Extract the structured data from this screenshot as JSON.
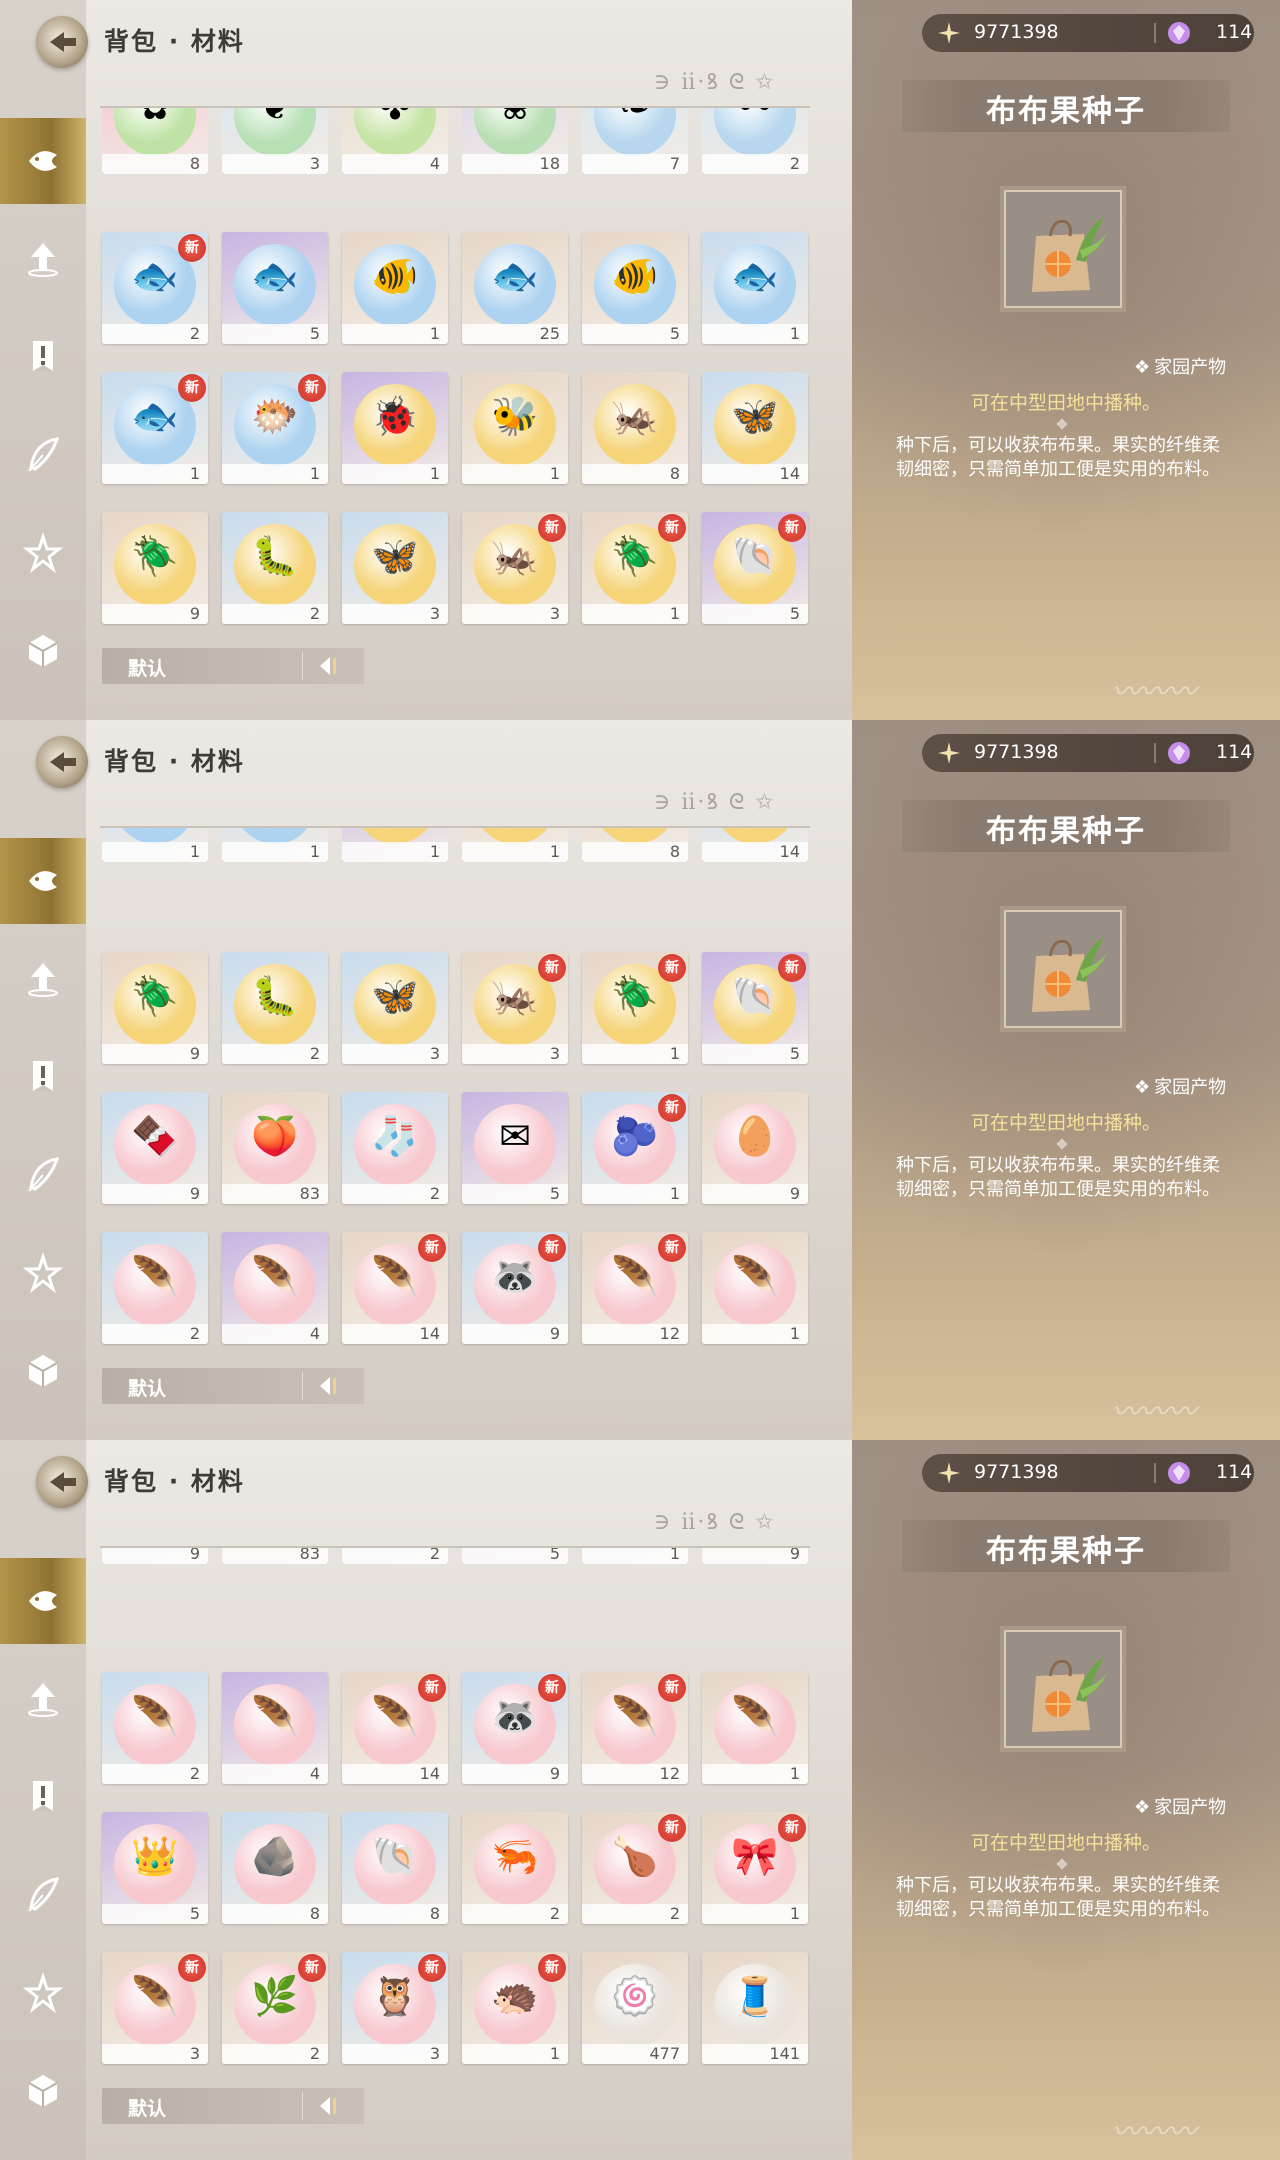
{
  "header": {
    "title": "背包 · 材料",
    "deco_text": "∋ ⅱ·ꝸ ᘓ ✩"
  },
  "sort": {
    "label": "默认"
  },
  "detail": {
    "gold": "9771398",
    "gems": "114",
    "name": "布布果种子",
    "category": "家园产物",
    "plant_hint": "可在中型田地中播种。",
    "description": "种下后，可以收获布布果。果实的纤维柔韧细密，只需简单加工便是实用的布料。"
  },
  "sidebar": [
    "fish-icon",
    "upgrade-icon",
    "quest-icon",
    "feather-icon",
    "star-icon",
    "box-icon"
  ],
  "panels": [
    {
      "rows": [
        {
          "partial": true,
          "cells": [
            {
              "qty": "8",
              "color": "#f4c6cf",
              "orb": "#bfe3a5",
              "glyph": "✿",
              "new": false
            },
            {
              "qty": "3",
              "color": "#d6e5ef",
              "orb": "#b8e0b5",
              "glyph": "❦",
              "new": false
            },
            {
              "qty": "4",
              "color": "#e9dfcf",
              "orb": "#c5e3a3",
              "glyph": "✤",
              "new": false
            },
            {
              "qty": "18",
              "color": "#dcd5ea",
              "orb": "#b9deb3",
              "glyph": "❀",
              "new": false
            },
            {
              "qty": "7",
              "color": "#d6e5ef",
              "orb": "#b6d7ee",
              "glyph": "❧",
              "new": false
            },
            {
              "qty": "2",
              "color": "#d6e5ef",
              "orb": "#b6d7ee",
              "glyph": "〰",
              "new": false
            }
          ]
        },
        {
          "partial": false,
          "cells": [
            {
              "qty": "2",
              "color": "#c9dcee",
              "orb": "#aed3f0",
              "glyph": "🐟",
              "new": true
            },
            {
              "qty": "5",
              "color": "#c7b5e2",
              "orb": "#aed3f0",
              "glyph": "🐟",
              "new": false
            },
            {
              "qty": "1",
              "color": "#e6d7c7",
              "orb": "#aed3f0",
              "glyph": "🐠",
              "new": false
            },
            {
              "qty": "25",
              "color": "#e6d7c7",
              "orb": "#aed3f0",
              "glyph": "🐟",
              "new": false
            },
            {
              "qty": "5",
              "color": "#e6d7c7",
              "orb": "#aed3f0",
              "glyph": "🐠",
              "new": false
            },
            {
              "qty": "1",
              "color": "#c9dcee",
              "orb": "#aed3f0",
              "glyph": "🐟",
              "new": false
            }
          ]
        },
        {
          "partial": false,
          "cells": [
            {
              "qty": "1",
              "color": "#c9dcee",
              "orb": "#aed3f0",
              "glyph": "🐟",
              "new": true
            },
            {
              "qty": "1",
              "color": "#c9dcee",
              "orb": "#aed3f0",
              "glyph": "🐡",
              "new": true
            },
            {
              "qty": "1",
              "color": "#c7b5e2",
              "orb": "#f5d47a",
              "glyph": "🐞",
              "new": false
            },
            {
              "qty": "1",
              "color": "#e6d7c7",
              "orb": "#f5d47a",
              "glyph": "🐝",
              "new": false
            },
            {
              "qty": "8",
              "color": "#e6d7c7",
              "orb": "#f5d47a",
              "glyph": "🦗",
              "new": false
            },
            {
              "qty": "14",
              "color": "#c9dcee",
              "orb": "#f5d47a",
              "glyph": "🦋",
              "new": false
            }
          ]
        },
        {
          "partial": false,
          "cells": [
            {
              "qty": "9",
              "color": "#e6d7c7",
              "orb": "#f5d47a",
              "glyph": "🪲",
              "new": false
            },
            {
              "qty": "2",
              "color": "#c9dcee",
              "orb": "#f5d47a",
              "glyph": "🐛",
              "new": false
            },
            {
              "qty": "3",
              "color": "#c9dcee",
              "orb": "#f5d47a",
              "glyph": "🦋",
              "new": false
            },
            {
              "qty": "3",
              "color": "#e6d7c7",
              "orb": "#f5d47a",
              "glyph": "🦗",
              "new": true
            },
            {
              "qty": "1",
              "color": "#e6d7c7",
              "orb": "#f5d47a",
              "glyph": "🪲",
              "new": true
            },
            {
              "qty": "5",
              "color": "#c7b5e2",
              "orb": "#f5d47a",
              "glyph": "🐚",
              "new": true
            }
          ]
        }
      ]
    },
    {
      "rows": [
        {
          "partial": true,
          "cells": [
            {
              "qty": "1",
              "color": "#c9dcee",
              "orb": "#aed3f0",
              "glyph": "🐟",
              "new": false
            },
            {
              "qty": "1",
              "color": "#c9dcee",
              "orb": "#aed3f0",
              "glyph": "🐡",
              "new": false
            },
            {
              "qty": "1",
              "color": "#c7b5e2",
              "orb": "#f5d47a",
              "glyph": "🐞",
              "new": false
            },
            {
              "qty": "1",
              "color": "#e6d7c7",
              "orb": "#f5d47a",
              "glyph": "🐝",
              "new": false
            },
            {
              "qty": "8",
              "color": "#e6d7c7",
              "orb": "#f5d47a",
              "glyph": "🦗",
              "new": false
            },
            {
              "qty": "14",
              "color": "#c9dcee",
              "orb": "#f5d47a",
              "glyph": "🦋",
              "new": false
            }
          ]
        },
        {
          "partial": false,
          "cells": [
            {
              "qty": "9",
              "color": "#e6d7c7",
              "orb": "#f5d47a",
              "glyph": "🪲",
              "new": false
            },
            {
              "qty": "2",
              "color": "#c9dcee",
              "orb": "#f5d47a",
              "glyph": "🐛",
              "new": false
            },
            {
              "qty": "3",
              "color": "#c9dcee",
              "orb": "#f5d47a",
              "glyph": "🦋",
              "new": false
            },
            {
              "qty": "3",
              "color": "#e6d7c7",
              "orb": "#f5d47a",
              "glyph": "🦗",
              "new": true
            },
            {
              "qty": "1",
              "color": "#e6d7c7",
              "orb": "#f5d47a",
              "glyph": "🪲",
              "new": true
            },
            {
              "qty": "5",
              "color": "#c7b5e2",
              "orb": "#f5d47a",
              "glyph": "🐚",
              "new": true
            }
          ]
        },
        {
          "partial": false,
          "cells": [
            {
              "qty": "9",
              "color": "#c9dcee",
              "orb": "#f7c9cf",
              "glyph": "🍫",
              "new": false
            },
            {
              "qty": "83",
              "color": "#e6d7c7",
              "orb": "#f7c9cf",
              "glyph": "🍑",
              "new": false
            },
            {
              "qty": "2",
              "color": "#c9dcee",
              "orb": "#f7c9cf",
              "glyph": "🧦",
              "new": false
            },
            {
              "qty": "5",
              "color": "#c7b5e2",
              "orb": "#f7c9cf",
              "glyph": "✉",
              "new": false
            },
            {
              "qty": "1",
              "color": "#c9dcee",
              "orb": "#f7c9cf",
              "glyph": "🫐",
              "new": true
            },
            {
              "qty": "9",
              "color": "#e6d7c7",
              "orb": "#f7c9cf",
              "glyph": "🥚",
              "new": false
            }
          ]
        },
        {
          "partial": false,
          "cells": [
            {
              "qty": "2",
              "color": "#c9dcee",
              "orb": "#f7c9cf",
              "glyph": "🪶",
              "new": false
            },
            {
              "qty": "4",
              "color": "#c7b5e2",
              "orb": "#f7c9cf",
              "glyph": "🪶",
              "new": false
            },
            {
              "qty": "14",
              "color": "#e6d7c7",
              "orb": "#f7c9cf",
              "glyph": "🪶",
              "new": true
            },
            {
              "qty": "9",
              "color": "#c9dcee",
              "orb": "#f7c9cf",
              "glyph": "🦝",
              "new": true
            },
            {
              "qty": "12",
              "color": "#e6d7c7",
              "orb": "#f7c9cf",
              "glyph": "🪶",
              "new": true
            },
            {
              "qty": "1",
              "color": "#e6d7c7",
              "orb": "#f7c9cf",
              "glyph": "🪶",
              "new": false
            }
          ]
        }
      ]
    },
    {
      "rows": [
        {
          "partial": true,
          "cells": [
            {
              "qty": "9",
              "color": "#c9dcee",
              "orb": "#f7c9cf",
              "glyph": "",
              "new": false
            },
            {
              "qty": "83",
              "color": "#e6d7c7",
              "orb": "#f7c9cf",
              "glyph": "",
              "new": false
            },
            {
              "qty": "2",
              "color": "#c9dcee",
              "orb": "#f7c9cf",
              "glyph": "",
              "new": false
            },
            {
              "qty": "5",
              "color": "#c7b5e2",
              "orb": "#f7c9cf",
              "glyph": "",
              "new": false
            },
            {
              "qty": "1",
              "color": "#c9dcee",
              "orb": "#f7c9cf",
              "glyph": "",
              "new": false
            },
            {
              "qty": "9",
              "color": "#e6d7c7",
              "orb": "#f7c9cf",
              "glyph": "",
              "new": false
            }
          ]
        },
        {
          "partial": false,
          "cells": [
            {
              "qty": "2",
              "color": "#c9dcee",
              "orb": "#f7c9cf",
              "glyph": "🪶",
              "new": false
            },
            {
              "qty": "4",
              "color": "#c7b5e2",
              "orb": "#f7c9cf",
              "glyph": "🪶",
              "new": false
            },
            {
              "qty": "14",
              "color": "#e6d7c7",
              "orb": "#f7c9cf",
              "glyph": "🪶",
              "new": true
            },
            {
              "qty": "9",
              "color": "#c9dcee",
              "orb": "#f7c9cf",
              "glyph": "🦝",
              "new": true
            },
            {
              "qty": "12",
              "color": "#e6d7c7",
              "orb": "#f7c9cf",
              "glyph": "🪶",
              "new": true
            },
            {
              "qty": "1",
              "color": "#e6d7c7",
              "orb": "#f7c9cf",
              "glyph": "🪶",
              "new": false
            }
          ]
        },
        {
          "partial": false,
          "cells": [
            {
              "qty": "5",
              "color": "#c7b5e2",
              "orb": "#f7c9cf",
              "glyph": "👑",
              "new": false
            },
            {
              "qty": "8",
              "color": "#c9dcee",
              "orb": "#f7c9cf",
              "glyph": "🪨",
              "new": false
            },
            {
              "qty": "8",
              "color": "#c9dcee",
              "orb": "#f7c9cf",
              "glyph": "🐚",
              "new": false
            },
            {
              "qty": "2",
              "color": "#e6d7c7",
              "orb": "#f7c9cf",
              "glyph": "🦐",
              "new": false
            },
            {
              "qty": "2",
              "color": "#e6d7c7",
              "orb": "#f7c9cf",
              "glyph": "🍗",
              "new": true
            },
            {
              "qty": "1",
              "color": "#e6d7c7",
              "orb": "#f7c9cf",
              "glyph": "🎀",
              "new": true
            }
          ]
        },
        {
          "partial": false,
          "cells": [
            {
              "qty": "3",
              "color": "#e6d7c7",
              "orb": "#f7c9cf",
              "glyph": "🪶",
              "new": true
            },
            {
              "qty": "2",
              "color": "#e6d7c7",
              "orb": "#f7c9cf",
              "glyph": "🌿",
              "new": true
            },
            {
              "qty": "3",
              "color": "#c9dcee",
              "orb": "#f7c9cf",
              "glyph": "🦉",
              "new": true
            },
            {
              "qty": "1",
              "color": "#e6d7c7",
              "orb": "#f7c9cf",
              "glyph": "🦔",
              "new": true
            },
            {
              "qty": "477",
              "color": "#e6d7c7",
              "orb": "#e9e3dc",
              "glyph": "🍥",
              "new": false
            },
            {
              "qty": "141",
              "color": "#e6d7c7",
              "orb": "#e9e3dc",
              "glyph": "🧵",
              "new": false
            }
          ]
        }
      ]
    }
  ],
  "new_badge": "新"
}
